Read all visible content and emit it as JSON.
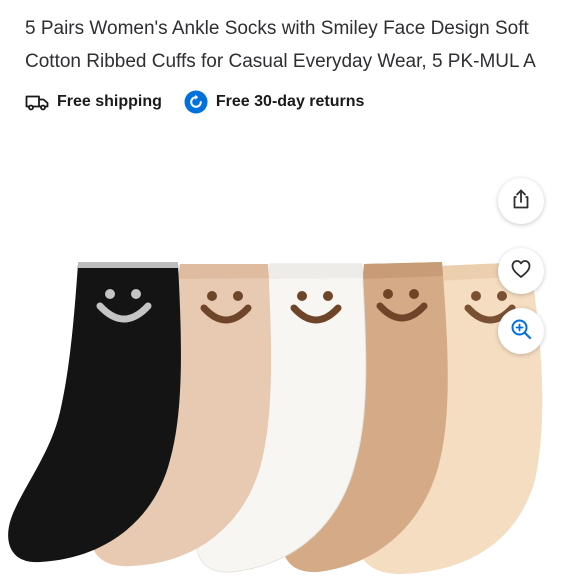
{
  "product": {
    "title": "5 Pairs Women's Ankle Socks with Smiley Face Design Soft Cotton Ribbed Cuffs for Casual Everyday Wear, 5 PK-MUL A"
  },
  "badges": [
    {
      "icon": "truck-icon",
      "label": "Free shipping"
    },
    {
      "icon": "returns-icon",
      "label": "Free 30-day returns",
      "icon_color": "#0071dc"
    }
  ],
  "image": {
    "alt": "Five pairs of ankle socks with smiley face design in black, beige, white, tan and cream",
    "sock_colors": [
      "#141414",
      "#e8c9b1",
      "#f7f6f3",
      "#d4ab86",
      "#f4ddc1"
    ]
  },
  "actions": [
    {
      "icon": "share-icon"
    },
    {
      "icon": "heart-icon"
    },
    {
      "icon": "zoom-in-icon",
      "color": "#0071dc"
    }
  ]
}
